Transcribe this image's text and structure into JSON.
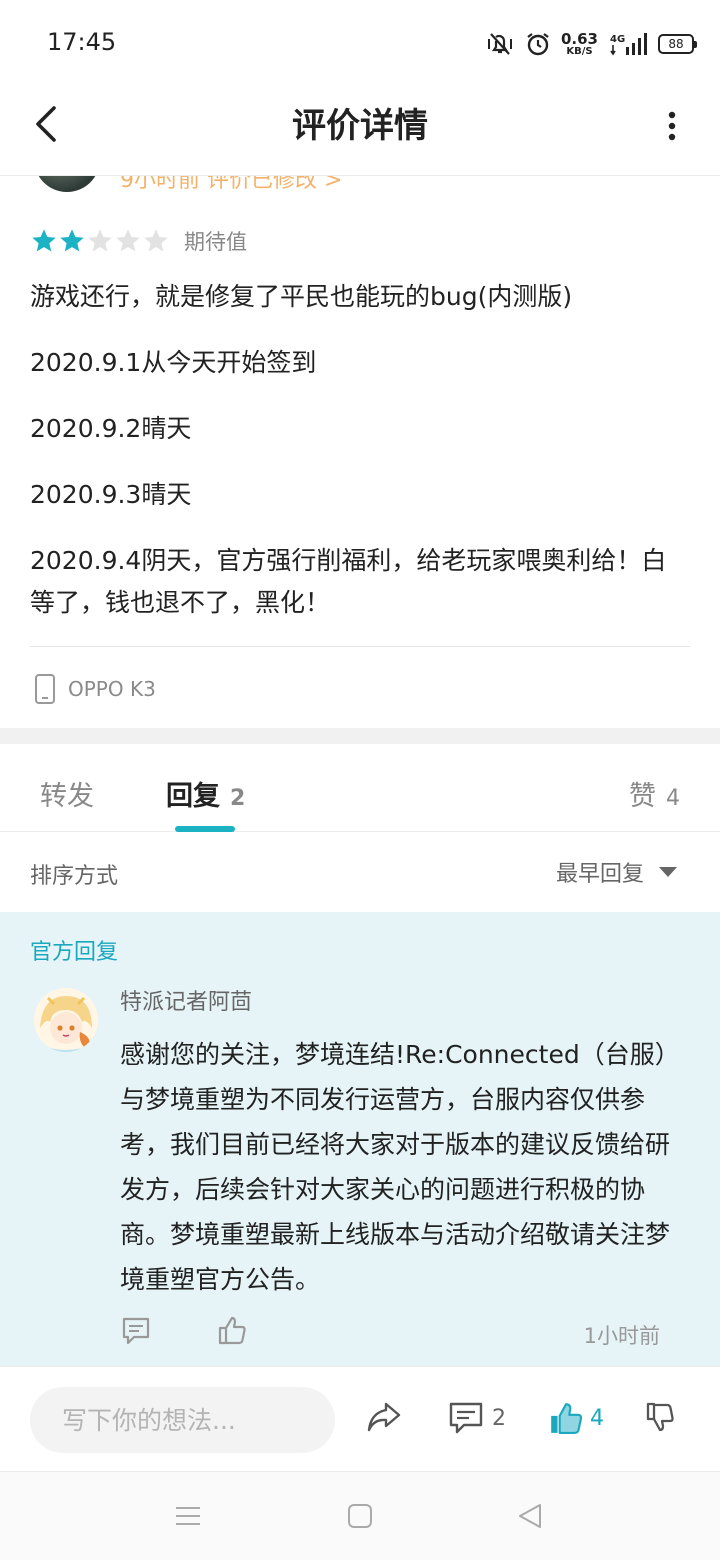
{
  "status_bar": {
    "time": "17:45",
    "net_speed_value": "0.63",
    "net_speed_unit": "KB/S",
    "network": "4G",
    "battery": "88"
  },
  "header": {
    "title": "评价详情"
  },
  "review": {
    "meta_text": "9小时前 评价已修改 >",
    "rating": 2,
    "rating_max": 5,
    "rating_label": "期待值",
    "paragraphs": [
      "游戏还行，就是修复了平民也能玩的bug(内测版)",
      "2020.9.1从今天开始签到",
      "2020.9.2晴天",
      "2020.9.3晴天",
      "2020.9.4阴天，官方强行削福利，给老玩家喂奥利给！白等了，钱也退不了，黑化！"
    ],
    "device": "OPPO K3"
  },
  "tabs": {
    "repost_label": "转发",
    "reply_label": "回复",
    "reply_count": "2",
    "like_label": "赞",
    "like_count": "4"
  },
  "sort": {
    "label": "排序方式",
    "selected": "最早回复"
  },
  "official_reply": {
    "tag": "官方回复",
    "author": "特派记者阿茴",
    "text": "感谢您的关注，梦境连结!Re:Connected（台服）与梦境重塑为不同发行运营方，台服内容仅供参考，我们目前已经将大家对于版本的建议反馈给研发方，后续会针对大家关心的问题进行积极的协商。梦境重塑最新上线版本与活动介绍敬请关注梦境重塑官方公告。",
    "time": "1小时前"
  },
  "action_bar": {
    "input_placeholder": "写下你的想法...",
    "comment_count": "2",
    "like_count": "4"
  },
  "colors": {
    "accent": "#1aa8bf",
    "star_on": "#1bb3c3",
    "star_off": "#e2e2e2",
    "meta": "#f3b26b",
    "official_bg": "#e6f4f8"
  }
}
